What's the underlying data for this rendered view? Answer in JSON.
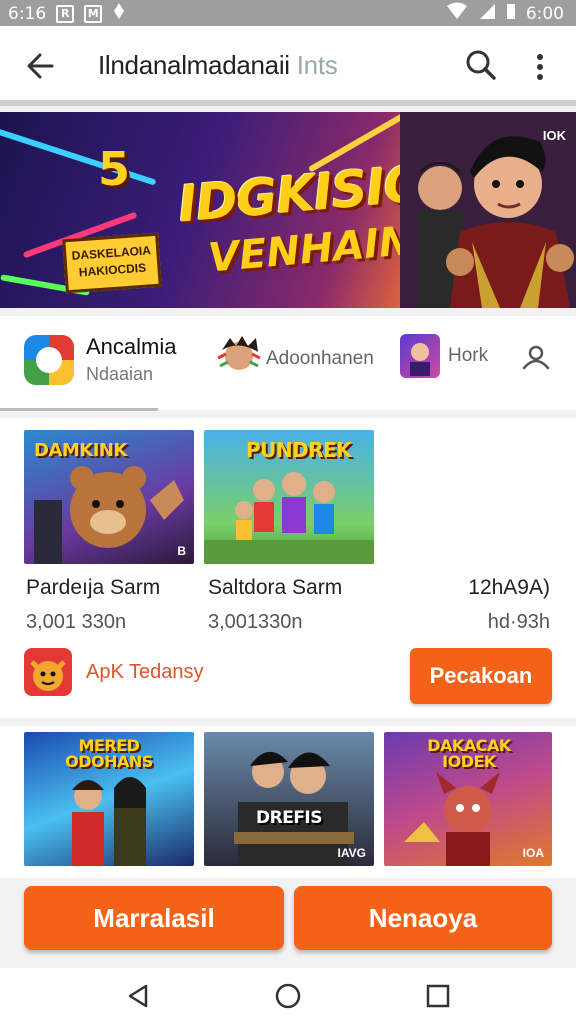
{
  "status": {
    "left_time": "6:16",
    "right_time": "6:00",
    "icon_1": "R",
    "icon_2": "M"
  },
  "appbar": {
    "title": "Ilndanalmadanaii",
    "subtitle": "Ints"
  },
  "banner": {
    "number": "5",
    "title_line1": "IDGKISIO!",
    "title_line2": "VENHAIN!",
    "badge": "DASKELAOIA HAKIOCDIS",
    "tag": "IOK"
  },
  "tabs": [
    {
      "title": "Ancalmia",
      "subtitle": "Ndaaian",
      "icon": "app-icon"
    },
    {
      "label": "Adoonhanen",
      "icon": "character-icon"
    },
    {
      "label": "Hork",
      "icon": "game-icon"
    }
  ],
  "featured": {
    "games": [
      {
        "title": "DAMKINK",
        "name": "Pardeıja Sarm",
        "size": "3,001 330n",
        "tag": "B"
      },
      {
        "title": "PUNDREK",
        "name": "Saltdora Sarm",
        "size": "3,001330n"
      },
      {
        "name": "12hA9A)",
        "size": "hd·93h"
      }
    ],
    "publisher": "ApK Tedansy",
    "primary_button": "Pecakoan"
  },
  "row2": [
    {
      "title": "MERED ODOHANS"
    },
    {
      "title": "DREFIS",
      "tag": "IAVG"
    },
    {
      "title": "DAKACAK IODEK",
      "tag": "IOA"
    }
  ],
  "buttons": {
    "left": "Marralasil",
    "right": "Nenaoya"
  },
  "colors": {
    "accent": "#f4621a",
    "status_bar": "#9e9e9e"
  }
}
